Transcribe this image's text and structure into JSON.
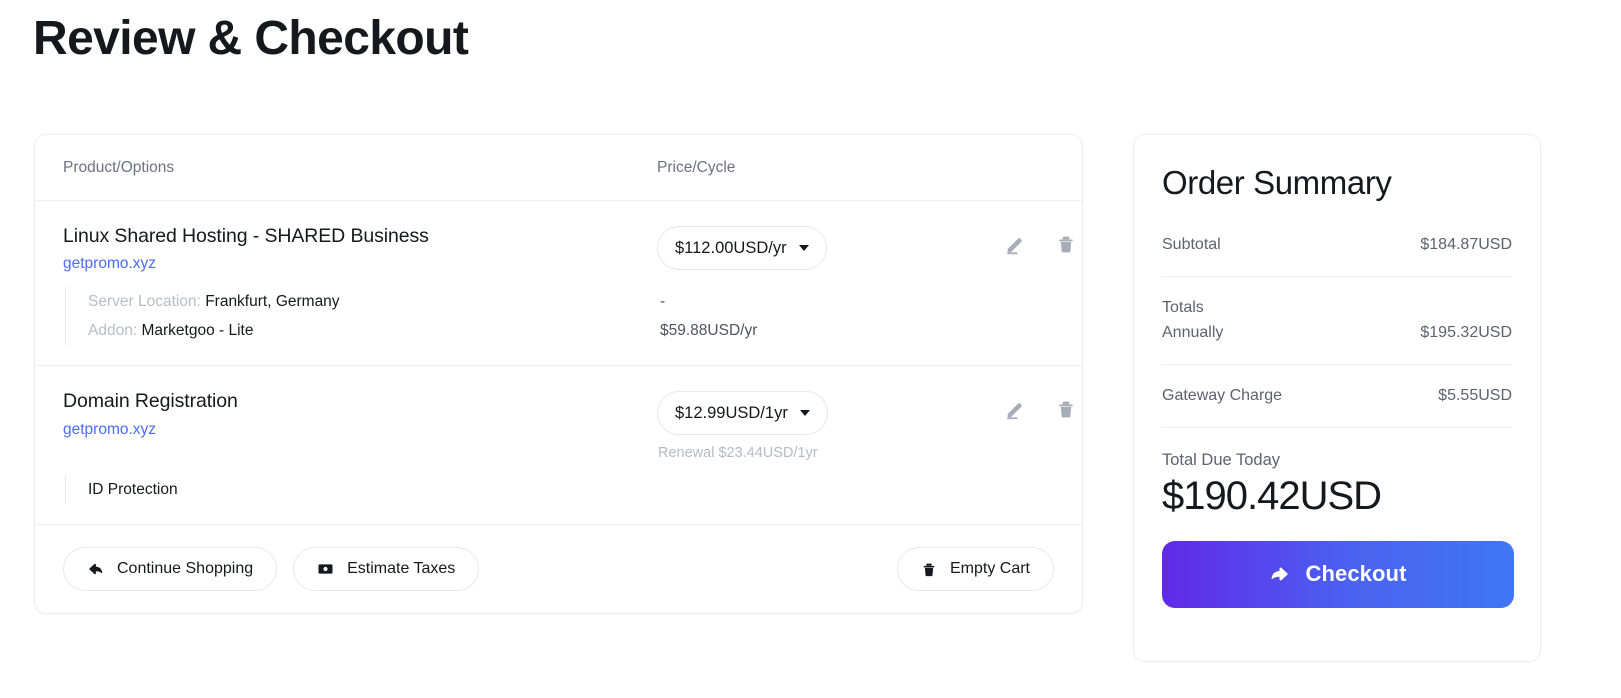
{
  "page": {
    "title": "Review & Checkout"
  },
  "cart": {
    "columns": {
      "product": "Product/Options",
      "price": "Price/Cycle"
    },
    "items": [
      {
        "name": "Linux Shared Hosting - SHARED Business",
        "domain": "getpromo.xyz",
        "price": "$112.00USD/yr",
        "renewal": "",
        "options": [
          {
            "key": "Server Location:",
            "value": "Frankfurt, Germany",
            "price": "-"
          },
          {
            "key": "Addon:",
            "value": "Marketgoo - Lite",
            "price": "$59.88USD/yr"
          }
        ]
      },
      {
        "name": "Domain Registration",
        "domain": "getpromo.xyz",
        "price": "$12.99USD/1yr",
        "renewal": "Renewal $23.44USD/1yr",
        "options": [
          {
            "key": "",
            "value": "ID Protection",
            "price": ""
          }
        ]
      }
    ],
    "footer": {
      "continue_shopping": "Continue Shopping",
      "estimate_taxes": "Estimate Taxes",
      "empty_cart": "Empty Cart"
    }
  },
  "summary": {
    "title": "Order Summary",
    "subtotal_label": "Subtotal",
    "subtotal_value": "$184.87USD",
    "totals_label": "Totals",
    "annually_label": "Annually",
    "annually_value": "$195.32USD",
    "gateway_label": "Gateway Charge",
    "gateway_value": "$5.55USD",
    "total_due_label": "Total Due Today",
    "total_due_value": "$190.42USD",
    "checkout_label": "Checkout"
  },
  "colors": {
    "link": "#4a6cf7",
    "checkout_gradient_start": "#6129e8",
    "checkout_gradient_end": "#3f76f6",
    "text_primary": "#16181d",
    "text_muted": "#6b7280"
  }
}
